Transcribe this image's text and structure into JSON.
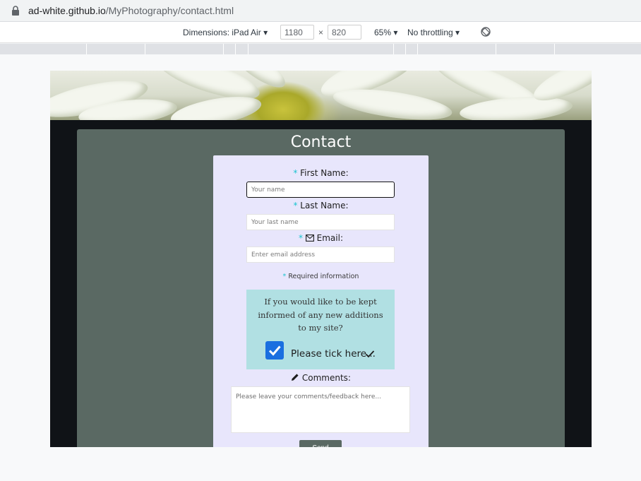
{
  "browser": {
    "url_host": "ad-white.github.io",
    "url_path": "/MyPhotography/contact.html"
  },
  "device_toolbar": {
    "dimensions_label": "Dimensions: iPad Air",
    "width_value": "1180",
    "height_value": "820",
    "times": "×",
    "zoom": "65%",
    "throttling": "No throttling",
    "icons": [
      "lock-icon",
      "dropdown-icon",
      "rotate-icon"
    ]
  },
  "page": {
    "title": "Contact",
    "form": {
      "required_mark": "*",
      "first_name_label": "First Name:",
      "first_name_placeholder": "Your name",
      "last_name_label": "Last Name:",
      "last_name_placeholder": "Your last name",
      "email_label": "Email:",
      "email_placeholder": "Enter email address",
      "required_note": "Required information",
      "newsletter_text": "If you would like to be kept informed of any new additions to my site?",
      "newsletter_checked": true,
      "tick_label": "Please tick here...",
      "comments_label": "Comments:",
      "comments_placeholder": "Please leave your comments/feedback here...",
      "submit_label": "Send"
    },
    "colors": {
      "page_bg": "#101317",
      "panel": "#5a6963",
      "form_bg": "#e8e6fc",
      "required": "#1bc4d0",
      "newsletter_box": "#b1e0e3",
      "checkbox": "#1a6fe0"
    }
  }
}
